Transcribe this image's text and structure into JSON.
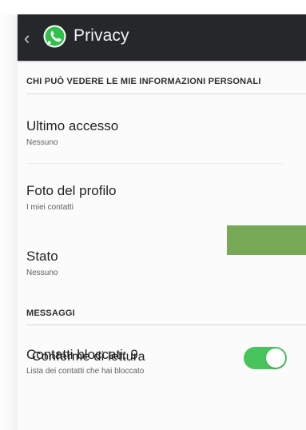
{
  "colors": {
    "action_bar": "#25272a",
    "accent_green": "#76a856",
    "toggle_on": "#47c55c",
    "whatsapp_green": "#2fbf4a"
  },
  "header": {
    "back_icon": "chevron-left-icon",
    "logo_icon": "whatsapp-logo-icon",
    "title": "Privacy"
  },
  "sections": {
    "personal_info_header": "CHI PUÒ VEDERE LE MIE INFORMAZIONI PERSONALI",
    "messages_header": "MESSAGGI"
  },
  "rows": {
    "last_seen": {
      "title": "Ultimo accesso",
      "value": "Nessuno"
    },
    "profile_photo": {
      "title": "Foto del profilo",
      "value": "I miei contatti"
    },
    "status": {
      "title": "Stato",
      "value": "Nessuno"
    },
    "blocked": {
      "title": "Contatti bloccati: 9",
      "subtitle": "Lista dei contatti che hai bloccato"
    }
  },
  "read_receipts": {
    "label": "Conferme di lettura",
    "enabled": true
  }
}
